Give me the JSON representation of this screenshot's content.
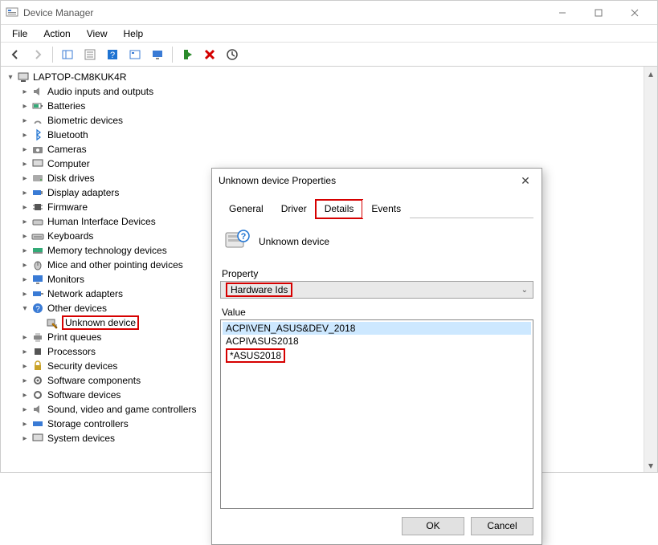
{
  "window": {
    "title": "Device Manager",
    "controls": {
      "min": "—",
      "max": "▢",
      "close": "✕"
    }
  },
  "menu": [
    "File",
    "Action",
    "View",
    "Help"
  ],
  "tree": {
    "root": "LAPTOP-CM8KUK4R",
    "cat": {
      "audio": "Audio inputs and outputs",
      "batt": "Batteries",
      "bio": "Biometric devices",
      "bt": "Bluetooth",
      "cam": "Cameras",
      "comp": "Computer",
      "disk": "Disk drives",
      "disp": "Display adapters",
      "fw": "Firmware",
      "hid": "Human Interface Devices",
      "kb": "Keyboards",
      "mem": "Memory technology devices",
      "mouse": "Mice and other pointing devices",
      "mon": "Monitors",
      "net": "Network adapters",
      "other": "Other devices",
      "unknown": "Unknown device",
      "print": "Print queues",
      "proc": "Processors",
      "sec": "Security devices",
      "swc": "Software components",
      "swd": "Software devices",
      "sound": "Sound, video and game controllers",
      "storage": "Storage controllers",
      "sys": "System devices"
    }
  },
  "dialog": {
    "title": "Unknown device Properties",
    "tabs": {
      "general": "General",
      "driver": "Driver",
      "details": "Details",
      "events": "Events"
    },
    "device_label": "Unknown device",
    "property_label": "Property",
    "property_value": "Hardware Ids",
    "value_label": "Value",
    "values": [
      "ACPI\\VEN_ASUS&DEV_2018",
      "ACPI\\ASUS2018",
      "*ASUS2018"
    ],
    "ok": "OK",
    "cancel": "Cancel"
  }
}
